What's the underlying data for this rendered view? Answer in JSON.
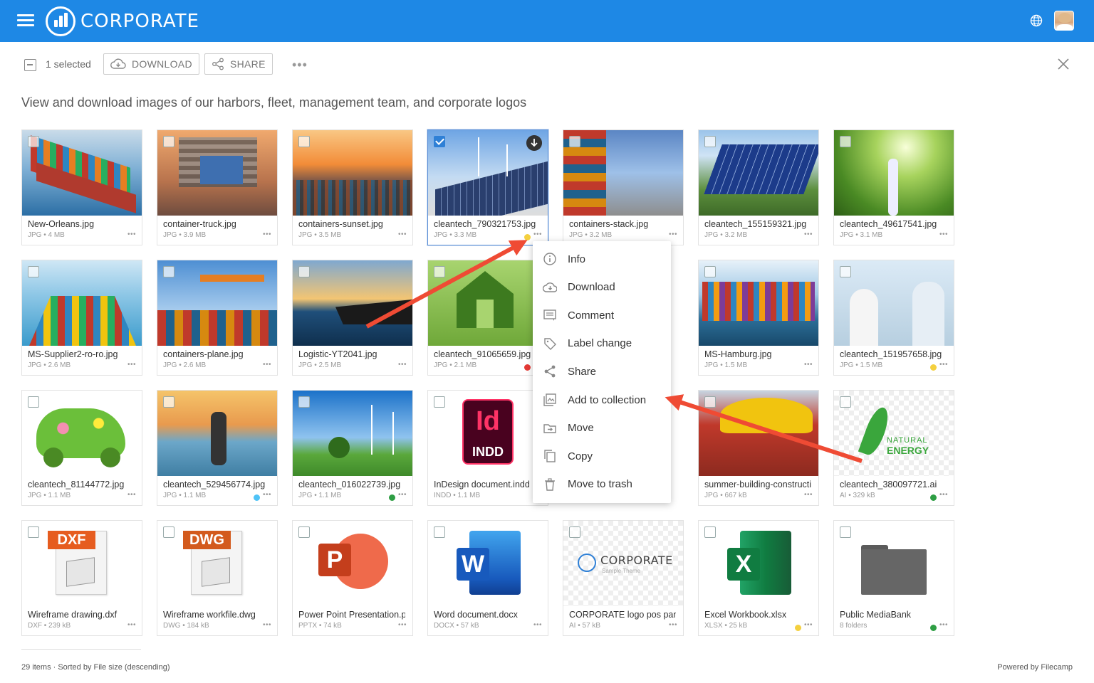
{
  "header": {
    "brand": "CORPORATE"
  },
  "toolbar": {
    "selected_label": "1 selected",
    "download_label": "DOWNLOAD",
    "share_label": "SHARE",
    "more_label": "•••"
  },
  "description": "View and download images of our harbors, fleet, management team, and corporate logos",
  "files": [
    {
      "name": "New-Orleans.jpg",
      "meta": "JPG • 4 MB",
      "status": null,
      "selected": false,
      "thumb": "ship"
    },
    {
      "name": "container-truck.jpg",
      "meta": "JPG • 3.9 MB",
      "status": null,
      "selected": false,
      "thumb": "crane"
    },
    {
      "name": "containers-sunset.jpg",
      "meta": "JPG • 3.5 MB",
      "status": null,
      "selected": false,
      "thumb": "sunset"
    },
    {
      "name": "cleantech_790321753.jpg",
      "meta": "JPG • 3.3 MB",
      "status": "#f4d03f",
      "selected": true,
      "thumb": "solar-wind"
    },
    {
      "name": "containers-stack.jpg",
      "meta": "JPG • 3.2 MB",
      "status": null,
      "selected": false,
      "thumb": "stack"
    },
    {
      "name": "cleantech_155159321.jpg",
      "meta": "JPG • 3.2 MB",
      "status": null,
      "selected": false,
      "thumb": "solar"
    },
    {
      "name": "cleantech_49617541.jpg",
      "meta": "JPG • 3.1 MB",
      "status": null,
      "selected": false,
      "thumb": "forest"
    },
    {
      "name": "MS-Supplier2-ro-ro.jpg",
      "meta": "JPG • 2.6 MB",
      "status": null,
      "selected": false,
      "thumb": "cargo-sea"
    },
    {
      "name": "containers-plane.jpg",
      "meta": "JPG • 2.6 MB",
      "status": null,
      "selected": false,
      "thumb": "plane"
    },
    {
      "name": "Logistic-YT2041.jpg",
      "meta": "JPG • 2.5 MB",
      "status": null,
      "selected": false,
      "thumb": "tanker"
    },
    {
      "name": "cleantech_91065659.jpg",
      "meta": "JPG • 2.1 MB",
      "status": "#e53935",
      "selected": false,
      "thumb": "green-house"
    },
    {
      "name": "MS-Hamburg.jpg",
      "meta": "JPG • 1.5 MB",
      "status": null,
      "selected": false,
      "thumb": "hamburg",
      "col": 5
    },
    {
      "name": "cleantech_151957658.jpg",
      "meta": "JPG • 1.5 MB",
      "status": "#f4d03f",
      "selected": false,
      "thumb": "engineers"
    },
    {
      "name": "cleantech_81144772.jpg",
      "meta": "JPG • 1.1 MB",
      "status": null,
      "selected": false,
      "thumb": "flower-car"
    },
    {
      "name": "cleantech_529456774.jpg",
      "meta": "JPG • 1.1 MB",
      "status": "#4fc3f7",
      "selected": false,
      "thumb": "runner"
    },
    {
      "name": "cleantech_016022739.jpg",
      "meta": "JPG • 1.1 MB",
      "status": "#2e9e44",
      "selected": false,
      "thumb": "turbines"
    },
    {
      "name": "InDesign document.indd",
      "meta": "INDD • 1.1 MB",
      "status": null,
      "selected": false,
      "thumb": "indd"
    },
    {
      "name": "summer-building-construction.jpg",
      "meta": "JPG • 667 kB",
      "status": null,
      "selected": false,
      "thumb": "helmets",
      "col": 5
    },
    {
      "name": "cleantech_380097721.ai",
      "meta": "AI • 329 kB",
      "status": "#2e9e44",
      "selected": false,
      "thumb": "natural-energy"
    },
    {
      "name": "Wireframe drawing.dxf",
      "meta": "DXF • 239 kB",
      "status": null,
      "selected": false,
      "thumb": "dxf"
    },
    {
      "name": "Wireframe workfile.dwg",
      "meta": "DWG • 184 kB",
      "status": null,
      "selected": false,
      "thumb": "dwg"
    },
    {
      "name": "Power Point Presentation.pptx",
      "meta": "PPTX • 74 kB",
      "status": null,
      "selected": false,
      "thumb": "pptx"
    },
    {
      "name": "Word document.docx",
      "meta": "DOCX • 57 kB",
      "status": null,
      "selected": false,
      "thumb": "docx"
    },
    {
      "name": "CORPORATE logo pos pantone.ai",
      "meta": "AI • 57 kB",
      "status": null,
      "selected": false,
      "thumb": "corp-logo"
    },
    {
      "name": "Excel Workbook.xlsx",
      "meta": "XLSX • 25 kB",
      "status": "#f4d03f",
      "selected": false,
      "thumb": "xlsx"
    },
    {
      "name": "Public MediaBank",
      "meta": "8 folders",
      "status": "#2e9e44",
      "selected": false,
      "thumb": "folder"
    }
  ],
  "context_menu": {
    "items": [
      {
        "label": "Info",
        "icon": "info-icon"
      },
      {
        "label": "Download",
        "icon": "cloud-download-icon"
      },
      {
        "label": "Comment",
        "icon": "comment-icon"
      },
      {
        "label": "Label change",
        "icon": "tag-icon"
      },
      {
        "label": "Share",
        "icon": "share-icon"
      },
      {
        "label": "Add to collection",
        "icon": "collection-icon"
      },
      {
        "label": "Move",
        "icon": "move-icon"
      },
      {
        "label": "Copy",
        "icon": "copy-icon"
      },
      {
        "label": "Move to trash",
        "icon": "trash-icon"
      }
    ]
  },
  "thumb_labels": {
    "dxf": "DXF",
    "dwg": "DWG",
    "indd_big": "Id",
    "indd_small": "INDD",
    "pptx": "P",
    "docx": "W",
    "xlsx": "X",
    "corp_logo": "CORPORATE",
    "corp_logo_sub": "Sample Theme",
    "natural": "NATURAL",
    "energy": "ENERGY"
  },
  "footer": {
    "summary": "29 items · Sorted by File size (descending)",
    "powered": "Powered by Filecamp"
  },
  "colors": {
    "header": "#1e88e5",
    "arrow": "#ef4b34",
    "selected_border": "#5b8fd6"
  }
}
